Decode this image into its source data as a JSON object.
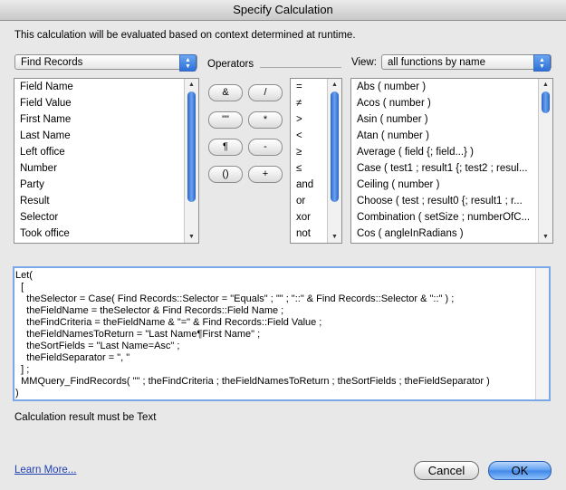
{
  "window": {
    "title": "Specify Calculation"
  },
  "description": "This calculation will be evaluated based on context determined at runtime.",
  "table_popup": {
    "value": "Find Records"
  },
  "fields": [
    "Field Name",
    "Field Value",
    "First Name",
    "Last Name",
    "Left office",
    "Number",
    "Party",
    "Result",
    "Selector",
    "Took office"
  ],
  "operators": {
    "label": "Operators",
    "buttons": [
      "&",
      "/",
      "\"\"",
      "*",
      "¶",
      "-",
      "()",
      "+"
    ],
    "list": [
      "=",
      "≠",
      ">",
      "<",
      "≥",
      "≤",
      "and",
      "or",
      "xor",
      "not"
    ]
  },
  "view": {
    "label": "View:",
    "value": "all functions by name",
    "functions": [
      "Abs ( number )",
      "Acos ( number )",
      "Asin ( number )",
      "Atan ( number )",
      "Average ( field {; field...} )",
      "Case ( test1 ; result1 {; test2 ; resul...",
      "Ceiling ( number )",
      "Choose ( test ; result0 {; result1 ; r...",
      "Combination ( setSize ; numberOfC...",
      "Cos ( angleInRadians )"
    ]
  },
  "calculation": "Let(\n  [\n    theSelector = Case( Find Records::Selector = \"Equals\" ; \"\" ; \"::\" & Find Records::Selector & \"::\" ) ;\n    theFieldName = theSelector & Find Records::Field Name ;\n    theFindCriteria = theFieldName & \"=\" & Find Records::Field Value ;\n    theFieldNamesToReturn = \"Last Name¶First Name\" ;\n    theSortFields = \"Last Name=Asc\" ;\n    theFieldSeparator = \", \"\n  ] ;\n  MMQuery_FindRecords( \"\" ; theFindCriteria ; theFieldNamesToReturn ; theSortFields ; theFieldSeparator )\n)",
  "result_type": "Calculation result must be Text",
  "footer": {
    "learn_more": "Learn More...",
    "cancel": "Cancel",
    "ok": "OK"
  }
}
